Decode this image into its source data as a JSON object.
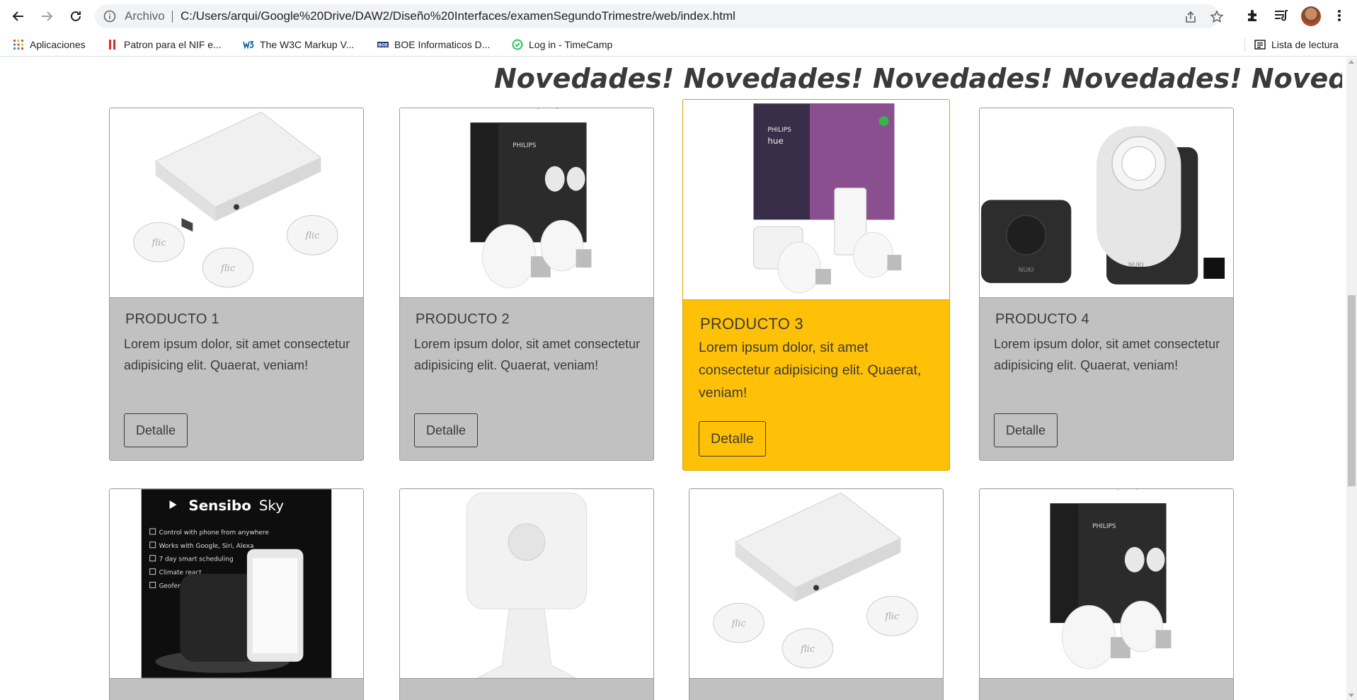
{
  "browser": {
    "scheme_label": "Archivo",
    "url": "C:/Users/arqui/Google%20Drive/DAW2/Diseño%20Interfaces/examenSegundoTrimestre/web/index.html",
    "icons": [
      "back-arrow-icon",
      "forward-arrow-icon",
      "reload-icon",
      "info-icon",
      "share-icon",
      "star-icon",
      "extensions-icon",
      "reading-list-icon",
      "avatar",
      "menu-icon"
    ]
  },
  "bookmarks": {
    "items": [
      {
        "label": "Aplicaciones",
        "icon": "apps-grid-icon"
      },
      {
        "label": "Patron para el NIF e...",
        "icon": "red-bars-icon"
      },
      {
        "label": "The W3C Markup V...",
        "icon": "w3c-icon"
      },
      {
        "label": "BOE Informaticos D...",
        "icon": "boe-icon"
      },
      {
        "label": "Log in - TimeCamp",
        "icon": "timecamp-icon"
      }
    ],
    "reading_list": "Lista de lectura"
  },
  "page": {
    "marquee_text": "Novedades! Novedades! Novedades! Novedades! Novedades! Novedades!",
    "products": [
      {
        "title": "PRODUCTO 1",
        "description": "Lorem ipsum dolor, sit amet consectetur adipisicing elit. Quaerat, veniam!",
        "button": "Detalle",
        "image": "flic-hub-with-buttons"
      },
      {
        "title": "PRODUCTO 2",
        "description": "Lorem ipsum dolor, sit amet consectetur adipisicing elit. Quaerat, veniam!",
        "button": "Detalle",
        "image": "philips-hue-white-bulbs"
      },
      {
        "title": "PRODUCTO 3",
        "description": "Lorem ipsum dolor, sit amet consectetur adipisicing elit. Quaerat, veniam!",
        "button": "Detalle",
        "image": "philips-hue-color-kit",
        "highlighted": true
      },
      {
        "title": "PRODUCTO 4",
        "description": "Lorem ipsum dolor, sit amet consectetur adipisicing elit. Quaerat, veniam!",
        "button": "Detalle",
        "image": "nuki-smart-lock"
      },
      {
        "title": "",
        "description": "",
        "button": "",
        "image": "sensibo-sky"
      },
      {
        "title": "",
        "description": "",
        "button": "",
        "image": "motion-sensor"
      },
      {
        "title": "",
        "description": "",
        "button": "",
        "image": "flic-hub-with-buttons"
      },
      {
        "title": "",
        "description": "",
        "button": "",
        "image": "philips-hue-white-bulbs"
      }
    ],
    "sensibo": {
      "brand": "Sensibo",
      "model": "Sky",
      "features": [
        "Control with phone from anywhere",
        "Works with Google, Siri, Alexa",
        "7 day smart scheduling",
        "Climate react",
        "Geofencing"
      ]
    },
    "nuki_label": "NUKI",
    "flic_label": "flic",
    "philips_label": "PHILIPS",
    "hue_label": "hue",
    "highlight_color": "#ffc107",
    "card_color": "#c1c1c1"
  }
}
